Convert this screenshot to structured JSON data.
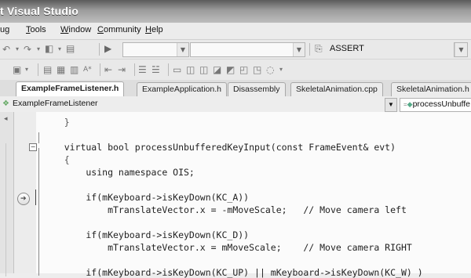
{
  "window": {
    "title": "t Visual Studio"
  },
  "menu": [
    {
      "pre": "ug",
      "u": "",
      "post": ""
    },
    {
      "pre": "",
      "u": "T",
      "post": "ools"
    },
    {
      "pre": "",
      "u": "W",
      "post": "indow"
    },
    {
      "pre": "",
      "u": "C",
      "post": "ommunity"
    },
    {
      "pre": "",
      "u": "H",
      "post": "elp"
    }
  ],
  "toolbar": {
    "find_combo_value": "ASSERT"
  },
  "tabs": [
    "ExampleFrameListener.h",
    "ExampleApplication.h",
    "Disassembly",
    "SkeletalAnimation.cpp",
    "SkeletalAnimation.h"
  ],
  "nav": {
    "class_combo": "ExampleFrameListener",
    "member_combo": "processUnbuffe"
  },
  "code": [
    "    }",
    "",
    "    virtual bool processUnbufferedKeyInput(const FrameEvent& evt)",
    "    {",
    "        using namespace OIS;",
    "",
    "        if(mKeyboard->isKeyDown(KC_A))",
    "            mTranslateVector.x = -mMoveScale;   // Move camera left",
    "",
    "        if(mKeyboard->isKeyDown(KC_D))",
    "            mTranslateVector.x = mMoveScale;    // Move camera RIGHT",
    "",
    "        if(mKeyboard->isKeyDown(KC_UP) || mKeyboard->isKeyDown(KC_W) )"
  ],
  "colors": {
    "title_bar": "#8a8a8a",
    "editor_bg": "#fbfbfb",
    "code_text": "#222222"
  }
}
